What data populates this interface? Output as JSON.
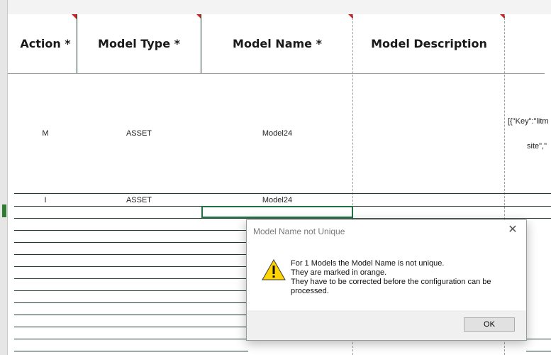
{
  "sheet": {
    "headers": [
      {
        "label": "Action *",
        "required": true
      },
      {
        "label": "Model Type *",
        "required": true
      },
      {
        "label": "Model Name *",
        "required": true
      },
      {
        "label": "Model Description",
        "required": false
      }
    ],
    "rows": [
      {
        "action": "M",
        "model_type": "ASSET",
        "model_name": "Model24",
        "json_part1": "[{\"Key\":\"litm",
        "json_part2": "site\",\""
      },
      {
        "action": "I",
        "model_type": "ASSET",
        "model_name": "Model24"
      }
    ]
  },
  "dialog": {
    "title": "Model Name not Unique",
    "icon": "warning-icon",
    "messages": [
      "For 1 Models the Model Name is not unique.",
      "They are marked in orange.",
      "They have to be corrected before the configuration can be",
      "processed."
    ],
    "ok_label": "OK",
    "close_label": "✕"
  },
  "colors": {
    "required_marker": "#c62828",
    "selection": "#217346",
    "warning": "#ffd400"
  }
}
